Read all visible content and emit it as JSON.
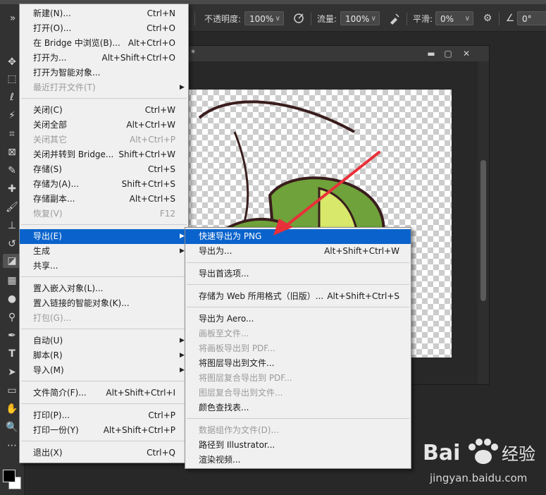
{
  "options_bar": {
    "opacity_label": "不透明度:",
    "opacity_value": "100%",
    "flow_label": "流量:",
    "flow_value": "100%",
    "smoothing_label": "平滑:",
    "smoothing_value": "0%",
    "angle_value": "0°",
    "icons": [
      "pressure-opacity-icon",
      "airbrush-icon",
      "settings-gear-icon",
      "angle-icon"
    ]
  },
  "document": {
    "title_fragment": "*",
    "buttons": [
      "minimize",
      "maximize",
      "close"
    ]
  },
  "file_menu": {
    "items": [
      {
        "label": "新建(N)...",
        "shortcut": "Ctrl+N"
      },
      {
        "label": "打开(O)...",
        "shortcut": "Ctrl+O"
      },
      {
        "label": "在 Bridge 中浏览(B)...",
        "shortcut": "Alt+Ctrl+O"
      },
      {
        "label": "打开为...",
        "shortcut": "Alt+Shift+Ctrl+O"
      },
      {
        "label": "打开为智能对象...",
        "shortcut": ""
      },
      {
        "label": "最近打开文件(T)",
        "shortcut": "",
        "submenu": true,
        "disabled": true
      },
      {
        "label": "关闭(C)",
        "shortcut": "Ctrl+W"
      },
      {
        "label": "关闭全部",
        "shortcut": "Alt+Ctrl+W"
      },
      {
        "label": "关闭其它",
        "shortcut": "Alt+Ctrl+P",
        "disabled": true
      },
      {
        "label": "关闭并转到 Bridge...",
        "shortcut": "Shift+Ctrl+W"
      },
      {
        "label": "存储(S)",
        "shortcut": "Ctrl+S"
      },
      {
        "label": "存储为(A)...",
        "shortcut": "Shift+Ctrl+S"
      },
      {
        "label": "存储副本...",
        "shortcut": "Alt+Ctrl+S"
      },
      {
        "label": "恢复(V)",
        "shortcut": "F12",
        "disabled": true
      },
      {
        "label": "导出(E)",
        "shortcut": "",
        "submenu": true,
        "highlighted": true
      },
      {
        "label": "生成",
        "shortcut": "",
        "submenu": true
      },
      {
        "label": "共享...",
        "shortcut": ""
      },
      {
        "label": "置入嵌入对象(L)...",
        "shortcut": ""
      },
      {
        "label": "置入链接的智能对象(K)...",
        "shortcut": ""
      },
      {
        "label": "打包(G)...",
        "shortcut": "",
        "disabled": true
      },
      {
        "label": "自动(U)",
        "shortcut": "",
        "submenu": true
      },
      {
        "label": "脚本(R)",
        "shortcut": "",
        "submenu": true
      },
      {
        "label": "导入(M)",
        "shortcut": "",
        "submenu": true
      },
      {
        "label": "文件简介(F)...",
        "shortcut": "Alt+Shift+Ctrl+I"
      },
      {
        "label": "打印(P)...",
        "shortcut": "Ctrl+P"
      },
      {
        "label": "打印一份(Y)",
        "shortcut": "Alt+Shift+Ctrl+P"
      },
      {
        "label": "退出(X)",
        "shortcut": "Ctrl+Q"
      }
    ]
  },
  "export_menu": {
    "items": [
      {
        "label": "快速导出为 PNG",
        "shortcut": "",
        "highlighted": true
      },
      {
        "label": "导出为...",
        "shortcut": "Alt+Shift+Ctrl+W"
      },
      {
        "label": "导出首选项...",
        "shortcut": ""
      },
      {
        "label": "存储为 Web 所用格式（旧版）...",
        "shortcut": "Alt+Shift+Ctrl+S"
      },
      {
        "label": "导出为 Aero...",
        "shortcut": ""
      },
      {
        "label": "画板至文件...",
        "shortcut": "",
        "disabled": true
      },
      {
        "label": "将画板导出到 PDF...",
        "shortcut": "",
        "disabled": true
      },
      {
        "label": "将图层导出到文件...",
        "shortcut": ""
      },
      {
        "label": "将图层复合导出到 PDF...",
        "shortcut": "",
        "disabled": true
      },
      {
        "label": "图层复合导出到文件...",
        "shortcut": "",
        "disabled": true
      },
      {
        "label": "颜色查找表...",
        "shortcut": ""
      },
      {
        "label": "数据组作为文件(D)...",
        "shortcut": "",
        "disabled": true
      },
      {
        "label": "路径到 Illustrator...",
        "shortcut": ""
      },
      {
        "label": "渲染视频...",
        "shortcut": ""
      }
    ]
  },
  "watermark": {
    "brand": "Bai 经验",
    "url": "jingyan.baidu.com"
  },
  "colors": {
    "menu_bg": "#f0f0f0",
    "highlight": "#0a63cc",
    "arrow": "#e8303a"
  }
}
